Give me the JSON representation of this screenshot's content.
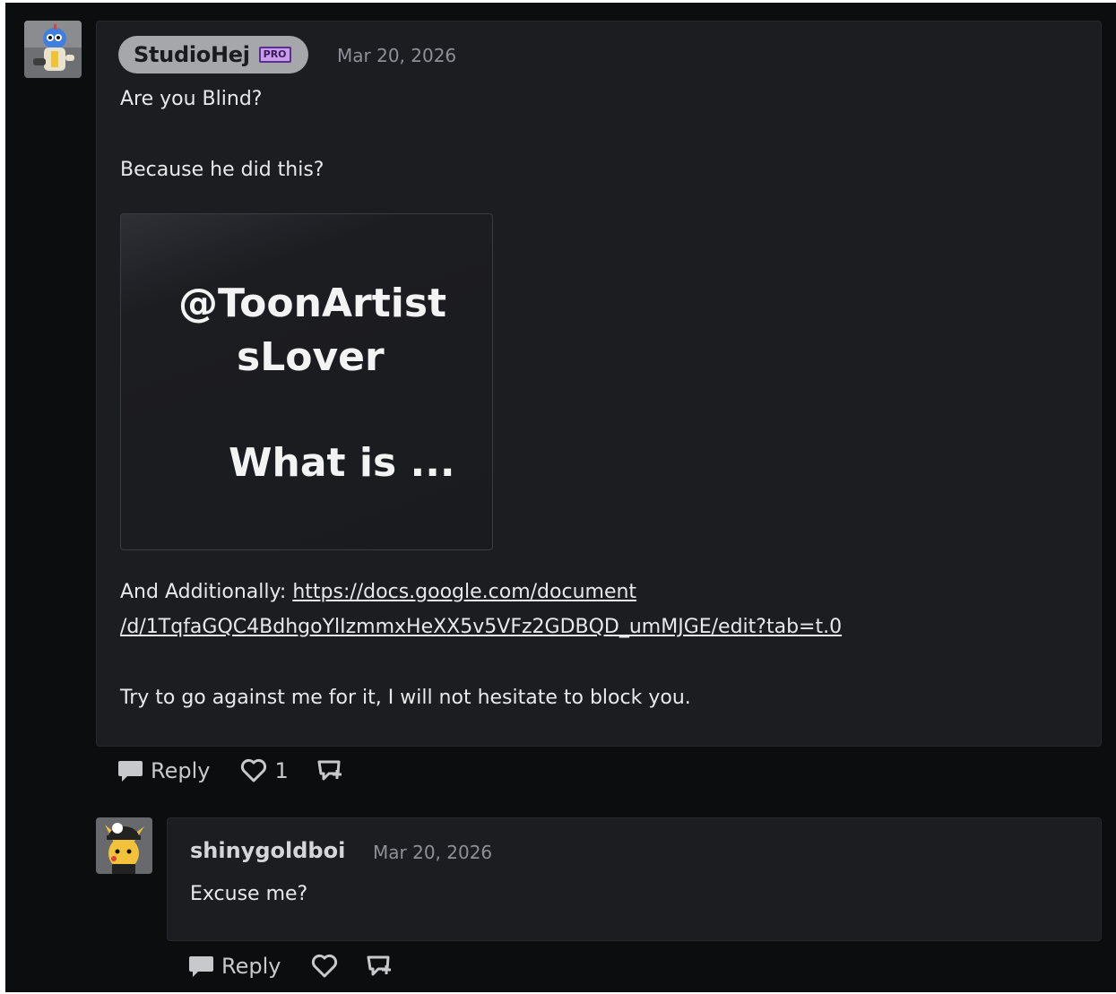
{
  "comments": [
    {
      "username": "StudioHej",
      "badge": "PRO",
      "date": "Mar 20, 2026",
      "lines": {
        "line1": "Are you Blind?",
        "line2": "Because he did this?",
        "additionally_prefix": "And Additionally: ",
        "link_line1": "https://docs.google.com/document",
        "link_line2": "/d/1TqfaGQC4BdhgoYlIzmmxHeXX5v5VFz2GDBQD_umMJGE/edit?tab=t.0",
        "line_last": "Try to go against me for it, I will not hesitate to block you."
      },
      "image_text": {
        "line1": "@ToonArtist",
        "line2": "sLover",
        "line3": "What is ..."
      },
      "actions": {
        "reply_label": "Reply",
        "like_count": "1"
      }
    },
    {
      "username": "shinygoldboi",
      "date": "Mar 20, 2026",
      "text": "Excuse me?",
      "actions": {
        "reply_label": "Reply"
      }
    }
  ],
  "icons": [
    "avatar-studiohej",
    "avatar-shinygoldboi",
    "speech-bubble-icon",
    "heart-icon",
    "tag-plus-icon"
  ],
  "colors": {
    "background": "#0c0d0f",
    "card": "#1b1d21",
    "pill": "#a6a7ab",
    "pro_badge": "#c79dec"
  }
}
